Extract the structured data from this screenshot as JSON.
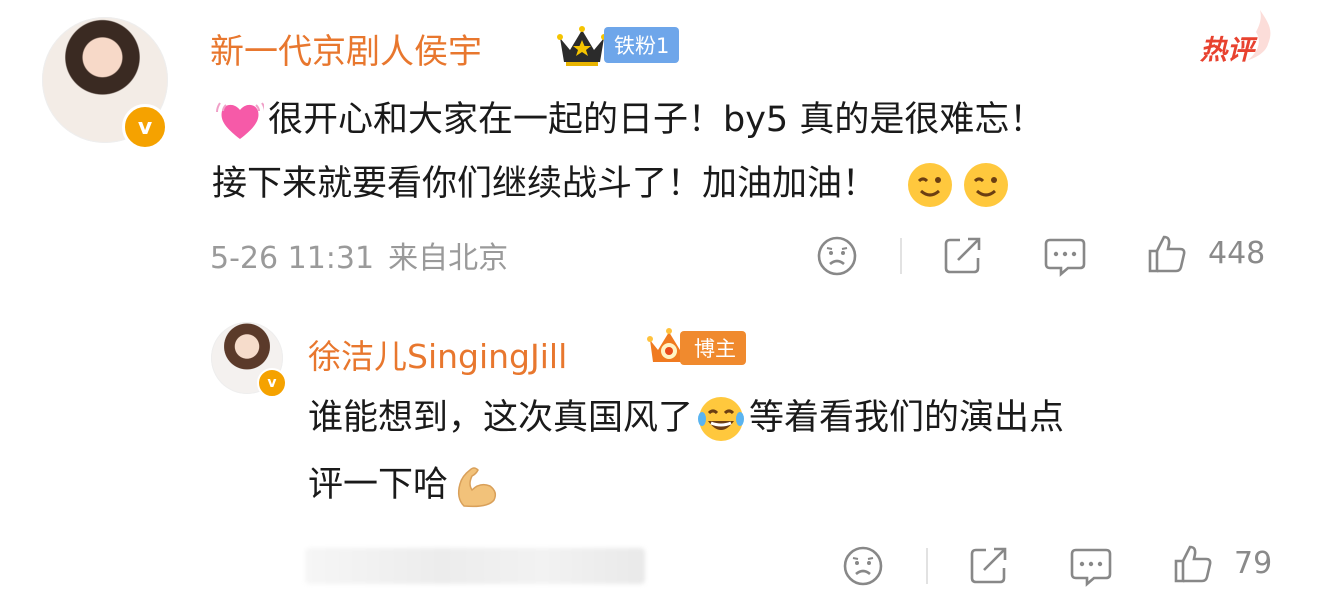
{
  "comment": {
    "author": "新一代京剧人侯宇",
    "fan_badge": "铁粉1",
    "hot_tag": "热评",
    "text_line1": "很开心和大家在一起的日子！by5 真的是很难忘！",
    "text_line2": "接下来就要看你们继续战斗了！加油加油！",
    "date": "5-26 11:31",
    "location": "来自北京",
    "likes": "448"
  },
  "reply": {
    "author": "徐洁儿SingingJill",
    "host_badge": "博主",
    "text_line1_a": "谁能想到，这次真国风了",
    "text_line1_b": "等着看我们的演出点",
    "text_line2": "评一下哈",
    "likes": "79"
  },
  "colors": {
    "name": "#e8772e",
    "meta": "#9a9a9a",
    "fan_badge": "#6ea6ea",
    "host_badge": "#f08a2e",
    "hot": "#e8422f"
  },
  "icons": [
    "crown-icon",
    "heart-pulse-emoji",
    "wink-emoji",
    "sad-face-icon",
    "share-icon",
    "comment-icon",
    "thumbs-up-icon",
    "laugh-tears-emoji",
    "flexed-biceps-emoji"
  ]
}
